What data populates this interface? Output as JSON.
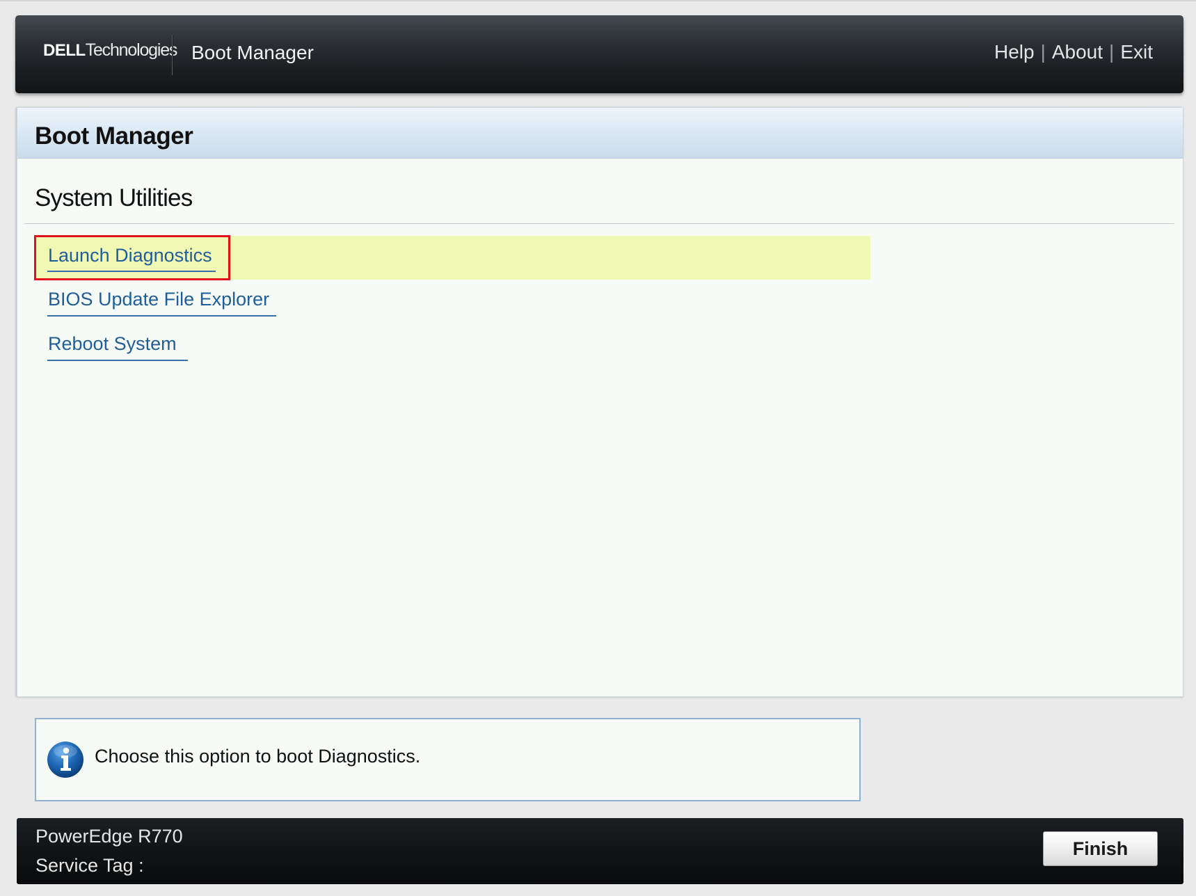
{
  "header": {
    "brand_dell": "DELL",
    "brand_technologies": "Technologies",
    "title": "Boot Manager",
    "links": {
      "help": "Help",
      "separator": "|",
      "about": "About",
      "exit": "Exit"
    }
  },
  "panel": {
    "title": "Boot Manager",
    "section_title": "System Utilities",
    "menu_items": [
      {
        "label": "Launch Diagnostics",
        "selected": true
      },
      {
        "label": "BIOS Update File Explorer",
        "selected": false
      },
      {
        "label": "Reboot System",
        "selected": false
      }
    ]
  },
  "info": {
    "icon": "info-icon",
    "text": "Choose this option to boot Diagnostics."
  },
  "footer": {
    "model": "PowerEdge R770",
    "service_tag_label": "Service Tag :",
    "finish_label": "Finish"
  },
  "colors": {
    "header_bg": "#1b1e21",
    "panel_bg": "#f7fbf7",
    "panel_header_bg": "#d9e8f4",
    "link_color": "#1f5e9a",
    "selection_bg": "#f0f8b4",
    "focus_border": "#e2121a",
    "footer_bg": "#0f1113"
  }
}
